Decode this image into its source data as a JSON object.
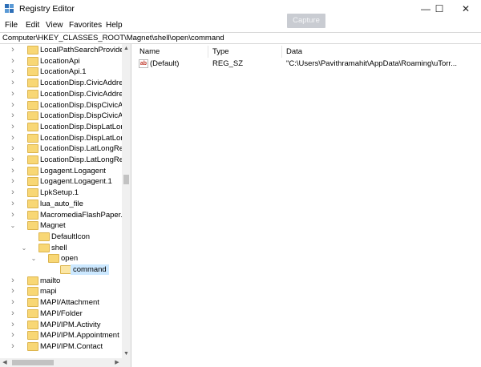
{
  "window": {
    "title": "Registry Editor",
    "capture_label": "Capture",
    "controls": {
      "minimize": "—",
      "maximize": "☐",
      "close": "✕"
    }
  },
  "menu": [
    "File",
    "Edit",
    "View",
    "Favorites",
    "Help"
  ],
  "address": "Computer\\HKEY_CLASSES_ROOT\\Magnet\\shell\\open\\command",
  "tree": [
    {
      "label": "LocalPathSearchProvider",
      "level": 0,
      "expander": "right",
      "state": "normal"
    },
    {
      "label": "LocationApi",
      "level": 0,
      "expander": "right",
      "state": "normal"
    },
    {
      "label": "LocationApi.1",
      "level": 0,
      "expander": "right",
      "state": "normal"
    },
    {
      "label": "LocationDisp.CivicAddres",
      "level": 0,
      "expander": "right",
      "state": "normal"
    },
    {
      "label": "LocationDisp.CivicAddres",
      "level": 0,
      "expander": "right",
      "state": "normal"
    },
    {
      "label": "LocationDisp.DispCivicAc",
      "level": 0,
      "expander": "right",
      "state": "normal"
    },
    {
      "label": "LocationDisp.DispCivicAc",
      "level": 0,
      "expander": "right",
      "state": "normal"
    },
    {
      "label": "LocationDisp.DispLatLong",
      "level": 0,
      "expander": "right",
      "state": "normal"
    },
    {
      "label": "LocationDisp.DispLatLong",
      "level": 0,
      "expander": "right",
      "state": "normal"
    },
    {
      "label": "LocationDisp.LatLongRep",
      "level": 0,
      "expander": "right",
      "state": "normal"
    },
    {
      "label": "LocationDisp.LatLongRep",
      "level": 0,
      "expander": "right",
      "state": "normal"
    },
    {
      "label": "Logagent.Logagent",
      "level": 0,
      "expander": "right",
      "state": "normal"
    },
    {
      "label": "Logagent.Logagent.1",
      "level": 0,
      "expander": "right",
      "state": "normal"
    },
    {
      "label": "LpkSetup.1",
      "level": 0,
      "expander": "right",
      "state": "normal"
    },
    {
      "label": "lua_auto_file",
      "level": 0,
      "expander": "right",
      "state": "normal"
    },
    {
      "label": "MacromediaFlashPaper.M",
      "level": 0,
      "expander": "right",
      "state": "normal"
    },
    {
      "label": "Magnet",
      "level": 0,
      "expander": "down",
      "state": "normal"
    },
    {
      "label": "DefaultIcon",
      "level": 1,
      "expander": "none",
      "state": "normal"
    },
    {
      "label": "shell",
      "level": 1,
      "expander": "down",
      "state": "normal"
    },
    {
      "label": "open",
      "level": 2,
      "expander": "down",
      "state": "normal"
    },
    {
      "label": "command",
      "level": 3,
      "expander": "none",
      "state": "selected"
    },
    {
      "label": "mailto",
      "level": 0,
      "expander": "right",
      "state": "normal"
    },
    {
      "label": "mapi",
      "level": 0,
      "expander": "right",
      "state": "normal"
    },
    {
      "label": "MAPI/Attachment",
      "level": 0,
      "expander": "right",
      "state": "normal"
    },
    {
      "label": "MAPI/Folder",
      "level": 0,
      "expander": "right",
      "state": "normal"
    },
    {
      "label": "MAPI/IPM.Activity",
      "level": 0,
      "expander": "right",
      "state": "normal"
    },
    {
      "label": "MAPI/IPM.Appointment",
      "level": 0,
      "expander": "right",
      "state": "normal"
    },
    {
      "label": "MAPI/IPM.Contact",
      "level": 0,
      "expander": "right",
      "state": "normal"
    }
  ],
  "values": {
    "columns": [
      "Name",
      "Type",
      "Data"
    ],
    "rows": [
      {
        "icon": "string-value-icon",
        "icon_text": "ab",
        "name": "(Default)",
        "type": "REG_SZ",
        "data": "\"C:\\Users\\Pavithramahit\\AppData\\Roaming\\uTorr..."
      }
    ]
  },
  "colors": {
    "selection": "#cce8ff",
    "folder": "#f8d775",
    "capture_button": "#c9ccd2"
  }
}
